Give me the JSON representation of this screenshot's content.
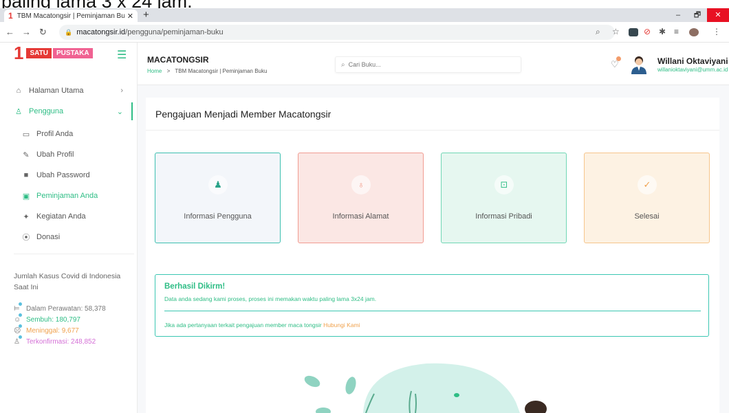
{
  "caption": {
    "text": "paling lama 3 x 24 jam."
  },
  "browser": {
    "tab_title": "TBM Macatongsir | Peminjaman Buku",
    "tab_favicon": "1",
    "new_tab_label": "+",
    "url_host": "macatongsir.id",
    "url_path": "/pengguna/peminjaman-buku",
    "window_controls": {
      "minimize": "–",
      "maximize": "🗗",
      "close": "✕"
    }
  },
  "sidebar": {
    "logo": {
      "number": "1",
      "word1": "SATU",
      "word2": "PUSTAKA"
    },
    "items": [
      {
        "label": "Halaman Utama",
        "icon": "home-icon"
      },
      {
        "label": "Pengguna",
        "icon": "user-icon"
      },
      {
        "label": "Profil Anda",
        "icon": "id-card-icon"
      },
      {
        "label": "Ubah Profil",
        "icon": "edit-icon"
      },
      {
        "label": "Ubah Password",
        "icon": "lock-icon"
      },
      {
        "label": "Peminjaman Anda",
        "icon": "book-icon"
      },
      {
        "label": "Kegiatan Anda",
        "icon": "activity-icon"
      },
      {
        "label": "Donasi",
        "icon": "donate-icon"
      }
    ],
    "covid": {
      "title": "Jumlah Kasus Covid di Indonesia Saat Ini",
      "stats": [
        {
          "text": "Dalam Perawatan: 58,378",
          "color": "#777777",
          "icon": "bed-icon"
        },
        {
          "text": "Sembuh: 180,797",
          "color": "#2ebd85",
          "icon": "smile-icon"
        },
        {
          "text": "Meninggal: 9,677",
          "color": "#f0a14d",
          "icon": "sad-icon"
        },
        {
          "text": "Terkonfirmasi: 248,852",
          "color": "#d46fd6",
          "icon": "group-icon"
        }
      ]
    }
  },
  "header": {
    "brand": "MACATONGSIR",
    "breadcrumb_home": "Home",
    "breadcrumb_sep": ">",
    "breadcrumb_current": "TBM Macatongsir | Peminjaman Buku",
    "search_placeholder": "Cari Buku...",
    "user_name": "Willani Oktaviyani",
    "user_email": "willanioktaviyani@umm.ac.id"
  },
  "main": {
    "title": "Pengajuan Menjadi Member Macatongsir",
    "steps": [
      {
        "label": "Informasi Pengguna",
        "icon": "person-icon"
      },
      {
        "label": "Informasi Alamat",
        "icon": "location-pin-icon"
      },
      {
        "label": "Informasi Pribadi",
        "icon": "unlock-icon"
      },
      {
        "label": "Selesai",
        "icon": "check-icon"
      }
    ],
    "alert": {
      "title": "Berhasil Dikirm!",
      "message": "Data anda sedang kami proses, proses ini memakan waktu paling lama 3x24 jam.",
      "footer_text": "Jika ada pertanyaan terkait pengajuan member maca tongsir",
      "footer_link": "Hubungi Kami"
    }
  },
  "colors": {
    "accent": "#2ebd85",
    "logo_red": "#e53935",
    "link_orange": "#f0a14d"
  }
}
